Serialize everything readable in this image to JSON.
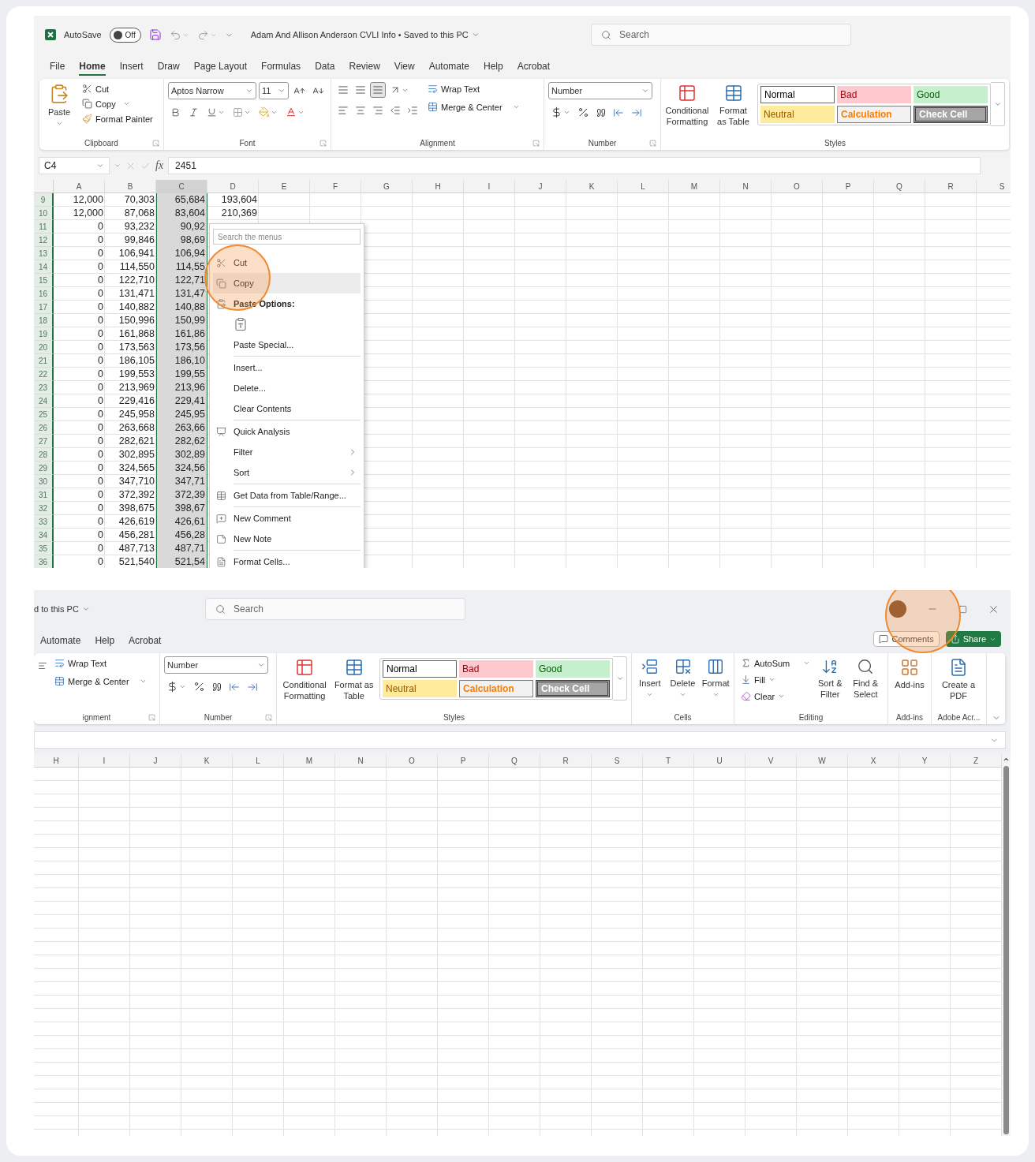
{
  "top_window": {
    "autosave": {
      "label": "AutoSave",
      "toggle": "Off",
      "on": false
    },
    "title": "Adam And Allison Anderson CVLI Info • Saved to this PC",
    "search": {
      "placeholder": "Search"
    },
    "tabs": [
      {
        "label": "File",
        "selected": false
      },
      {
        "label": "Home",
        "selected": true
      },
      {
        "label": "Insert",
        "selected": false
      },
      {
        "label": "Draw",
        "selected": false
      },
      {
        "label": "Page Layout",
        "selected": false
      },
      {
        "label": "Formulas",
        "selected": false
      },
      {
        "label": "Data",
        "selected": false
      },
      {
        "label": "Review",
        "selected": false
      },
      {
        "label": "View",
        "selected": false
      },
      {
        "label": "Automate",
        "selected": false
      },
      {
        "label": "Help",
        "selected": false
      },
      {
        "label": "Acrobat",
        "selected": false
      }
    ],
    "ribbon": {
      "clipboard": {
        "paste": "Paste",
        "cut": "Cut",
        "copy": "Copy",
        "format_painter": "Format Painter",
        "label": "Clipboard"
      },
      "font": {
        "font_name": "Aptos Narrow",
        "font_size": "11",
        "label": "Font"
      },
      "alignment": {
        "wrap_text": "Wrap Text",
        "merge_center": "Merge & Center",
        "label": "Alignment"
      },
      "number": {
        "format": "Number",
        "label": "Number"
      },
      "styles": {
        "conditional_formatting": "Conditional Formatting",
        "format_as_table": "Format as Table",
        "label": "Styles",
        "gallery": [
          {
            "label": "Normal",
            "kind": "normal"
          },
          {
            "label": "Bad",
            "kind": "bad"
          },
          {
            "label": "Good",
            "kind": "good"
          },
          {
            "label": "Neutral",
            "kind": "neutral"
          },
          {
            "label": "Calculation",
            "kind": "calculation"
          },
          {
            "label": "Check Cell",
            "kind": "check"
          }
        ]
      }
    },
    "formula_bar": {
      "name_box": "C4",
      "function_label": "fx",
      "value": "2451"
    },
    "grid": {
      "columns": [
        {
          "label": "A",
          "selected": false
        },
        {
          "label": "B",
          "selected": false
        },
        {
          "label": "C",
          "selected": true
        },
        {
          "label": "D",
          "selected": false
        },
        {
          "label": "E",
          "selected": false
        },
        {
          "label": "F",
          "selected": false
        },
        {
          "label": "G",
          "selected": false
        },
        {
          "label": "H",
          "selected": false
        },
        {
          "label": "I",
          "selected": false
        },
        {
          "label": "J",
          "selected": false
        },
        {
          "label": "K",
          "selected": false
        },
        {
          "label": "L",
          "selected": false
        },
        {
          "label": "M",
          "selected": false
        },
        {
          "label": "N",
          "selected": false
        },
        {
          "label": "O",
          "selected": false
        },
        {
          "label": "P",
          "selected": false
        },
        {
          "label": "Q",
          "selected": false
        },
        {
          "label": "R",
          "selected": false
        },
        {
          "label": "S",
          "selected": false
        }
      ],
      "rows": [
        {
          "number": "9",
          "cells": [
            "12,000",
            "70,303",
            "65,684",
            "193,604"
          ]
        },
        {
          "number": "10",
          "cells": [
            "12,000",
            "87,068",
            "83,604",
            "210,369"
          ]
        },
        {
          "number": "11",
          "cells": [
            "0",
            "93,232",
            "90,92"
          ]
        },
        {
          "number": "12",
          "cells": [
            "0",
            "99,846",
            "98,69"
          ]
        },
        {
          "number": "13",
          "cells": [
            "0",
            "106,941",
            "106,94"
          ]
        },
        {
          "number": "14",
          "cells": [
            "0",
            "114,550",
            "114,55"
          ]
        },
        {
          "number": "15",
          "cells": [
            "0",
            "122,710",
            "122,71"
          ]
        },
        {
          "number": "16",
          "cells": [
            "0",
            "131,471",
            "131,47"
          ]
        },
        {
          "number": "17",
          "cells": [
            "0",
            "140,882",
            "140,88"
          ]
        },
        {
          "number": "18",
          "cells": [
            "0",
            "150,996",
            "150,99"
          ]
        },
        {
          "number": "19",
          "cells": [
            "0",
            "161,868",
            "161,86"
          ]
        },
        {
          "number": "20",
          "cells": [
            "0",
            "173,563",
            "173,56"
          ]
        },
        {
          "number": "21",
          "cells": [
            "0",
            "186,105",
            "186,10"
          ]
        },
        {
          "number": "22",
          "cells": [
            "0",
            "199,553",
            "199,55"
          ]
        },
        {
          "number": "23",
          "cells": [
            "0",
            "213,969",
            "213,96"
          ]
        },
        {
          "number": "24",
          "cells": [
            "0",
            "229,416",
            "229,41"
          ]
        },
        {
          "number": "25",
          "cells": [
            "0",
            "245,958",
            "245,95"
          ]
        },
        {
          "number": "26",
          "cells": [
            "0",
            "263,668",
            "263,66"
          ]
        },
        {
          "number": "27",
          "cells": [
            "0",
            "282,621",
            "282,62"
          ]
        },
        {
          "number": "28",
          "cells": [
            "0",
            "302,895",
            "302,89"
          ]
        },
        {
          "number": "29",
          "cells": [
            "0",
            "324,565",
            "324,56"
          ]
        },
        {
          "number": "30",
          "cells": [
            "0",
            "347,710",
            "347,71"
          ]
        },
        {
          "number": "31",
          "cells": [
            "0",
            "372,392",
            "372,39"
          ]
        },
        {
          "number": "32",
          "cells": [
            "0",
            "398,675",
            "398,67"
          ]
        },
        {
          "number": "33",
          "cells": [
            "0",
            "426,619",
            "426,61"
          ]
        },
        {
          "number": "34",
          "cells": [
            "0",
            "456,281",
            "456,28"
          ]
        },
        {
          "number": "35",
          "cells": [
            "0",
            "487,713",
            "487,71"
          ]
        },
        {
          "number": "36",
          "cells": [
            "0",
            "521,540",
            "521,54"
          ]
        }
      ]
    },
    "context_menu": {
      "search": {
        "placeholder": "Search the menus"
      },
      "items": [
        {
          "kind": "item",
          "label": "Cut",
          "selected": false,
          "divider_before": false
        },
        {
          "kind": "item",
          "label": "Copy",
          "selected": true,
          "divider_before": false
        },
        {
          "kind": "header",
          "label": "Paste Options:",
          "selected": false,
          "divider_before": false
        },
        {
          "kind": "paste-icons",
          "selected": false,
          "divider_before": false
        },
        {
          "kind": "item",
          "label": "Paste Special...",
          "selected": false,
          "divider_before": false
        },
        {
          "kind": "item",
          "label": "Insert...",
          "selected": false,
          "divider_before": true
        },
        {
          "kind": "item",
          "label": "Delete...",
          "selected": false,
          "divider_before": false
        },
        {
          "kind": "item",
          "label": "Clear Contents",
          "selected": false,
          "divider_before": false
        },
        {
          "kind": "item",
          "label": "Quick Analysis",
          "selected": false,
          "divider_before": true
        },
        {
          "kind": "submenu",
          "label": "Filter",
          "selected": false,
          "divider_before": false
        },
        {
          "kind": "submenu",
          "label": "Sort",
          "selected": false,
          "divider_before": false
        },
        {
          "kind": "item",
          "label": "Get Data from Table/Range...",
          "selected": false,
          "divider_before": true
        },
        {
          "kind": "item",
          "label": "New Comment",
          "selected": false,
          "divider_before": true
        },
        {
          "kind": "item",
          "label": "New Note",
          "selected": false,
          "divider_before": false
        },
        {
          "kind": "item",
          "label": "Format Cells...",
          "selected": false,
          "divider_before": true
        }
      ]
    }
  },
  "bottom_window": {
    "title": "d to this PC",
    "search": {
      "placeholder": "Search"
    },
    "tabs": [
      {
        "label": "Automate",
        "selected": false
      },
      {
        "label": "Help",
        "selected": false
      },
      {
        "label": "Acrobat",
        "selected": false
      }
    ],
    "comments": "Comments",
    "share": "Share",
    "ribbon": {
      "alignment": {
        "wrap_text": "Wrap Text",
        "merge_center": "Merge & Center",
        "label": "ignment"
      },
      "number": {
        "format": "Number",
        "label": "Number"
      },
      "styles": {
        "conditional_formatting": "Conditional Formatting",
        "format_as_table": "Format as Table",
        "label": "Styles",
        "gallery": [
          {
            "label": "Normal",
            "kind": "normal"
          },
          {
            "label": "Bad",
            "kind": "bad"
          },
          {
            "label": "Good",
            "kind": "good"
          },
          {
            "label": "Neutral",
            "kind": "neutral"
          },
          {
            "label": "Calculation",
            "kind": "calculation"
          },
          {
            "label": "Check Cell",
            "kind": "check"
          }
        ]
      },
      "cells": {
        "buttons": [
          "Insert",
          "Delete",
          "Format"
        ],
        "label": "Cells"
      },
      "editing": {
        "autosum": "AutoSum",
        "fill": "Fill",
        "clear": "Clear",
        "sort_filter": "Sort & Filter",
        "find_select": "Find & Select",
        "label": "Editing"
      },
      "addins": {
        "button": "Add-ins",
        "label": "Add-ins"
      },
      "adobe": {
        "button": "Create a PDF",
        "label": "Adobe Acr..."
      }
    },
    "grid": {
      "columns": [
        "H",
        "I",
        "J",
        "K",
        "L",
        "M",
        "N",
        "O",
        "P",
        "Q",
        "R",
        "S",
        "T",
        "U",
        "V",
        "W",
        "X",
        "Y",
        "Z"
      ]
    }
  }
}
